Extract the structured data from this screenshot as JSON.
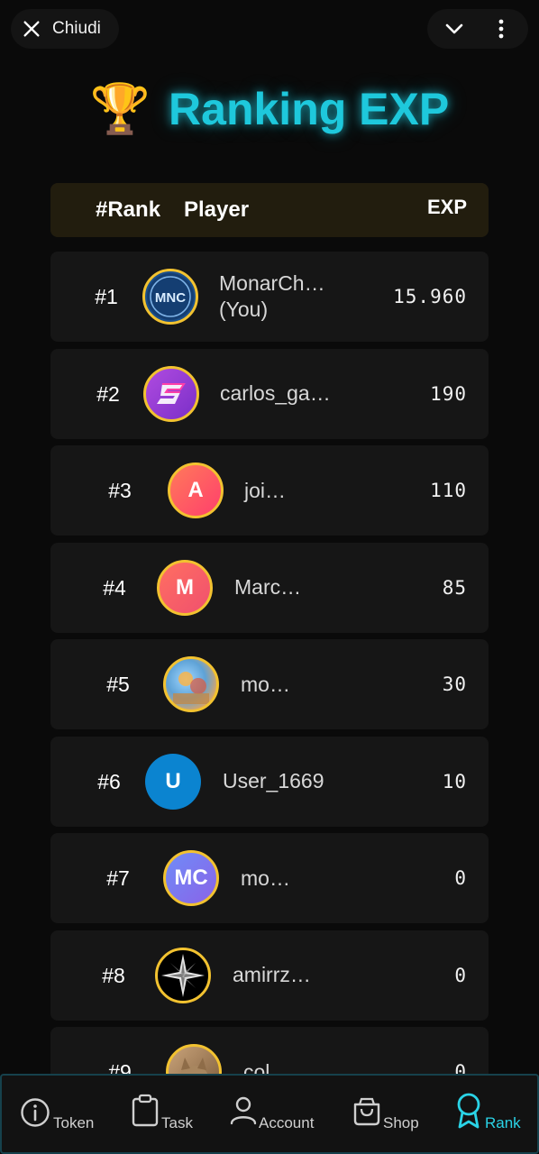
{
  "topbar": {
    "close_label": "Chiudi"
  },
  "title": {
    "icon": "🏆",
    "text": "Ranking EXP"
  },
  "table": {
    "headers": {
      "rank": "#Rank",
      "player": "Player",
      "exp": "EXP"
    },
    "rows": [
      {
        "rank": "#1",
        "name": "MonarCh…\n(You)",
        "exp": "15.960",
        "avatar": "MNC",
        "avatar_kind": "logo-mnc"
      },
      {
        "rank": "#2",
        "name": "carlos_ga…",
        "exp": "190",
        "avatar": "",
        "avatar_kind": "logo-s"
      },
      {
        "rank": "#3",
        "name": "joi…",
        "exp": "110",
        "avatar": "A",
        "avatar_kind": "letter"
      },
      {
        "rank": "#4",
        "name": "Marc…",
        "exp": "85",
        "avatar": "M",
        "avatar_kind": "letter"
      },
      {
        "rank": "#5",
        "name": "mo…",
        "exp": "30",
        "avatar": "",
        "avatar_kind": "photo"
      },
      {
        "rank": "#6",
        "name": "User_1669",
        "exp": "10",
        "avatar": "U",
        "avatar_kind": "letter"
      },
      {
        "rank": "#7",
        "name": "mo…",
        "exp": "0",
        "avatar": "MC",
        "avatar_kind": "letter"
      },
      {
        "rank": "#8",
        "name": "amirrz…",
        "exp": "0",
        "avatar": "",
        "avatar_kind": "compass"
      },
      {
        "rank": "#9",
        "name": "col…",
        "exp": "0",
        "avatar": "",
        "avatar_kind": "photo-cat"
      }
    ]
  },
  "nav": {
    "items": [
      {
        "label": "Token",
        "icon": "info-icon"
      },
      {
        "label": "Task",
        "icon": "clipboard-icon"
      },
      {
        "label": "Account",
        "icon": "user-icon"
      },
      {
        "label": "Shop",
        "icon": "bag-icon"
      },
      {
        "label": "Rank",
        "icon": "award-icon",
        "active": true
      }
    ]
  },
  "colors": {
    "accent": "#1ec8dc",
    "gold_border": "#f2c230",
    "row_bg": "#161616",
    "header_bg": "#221d0e"
  }
}
